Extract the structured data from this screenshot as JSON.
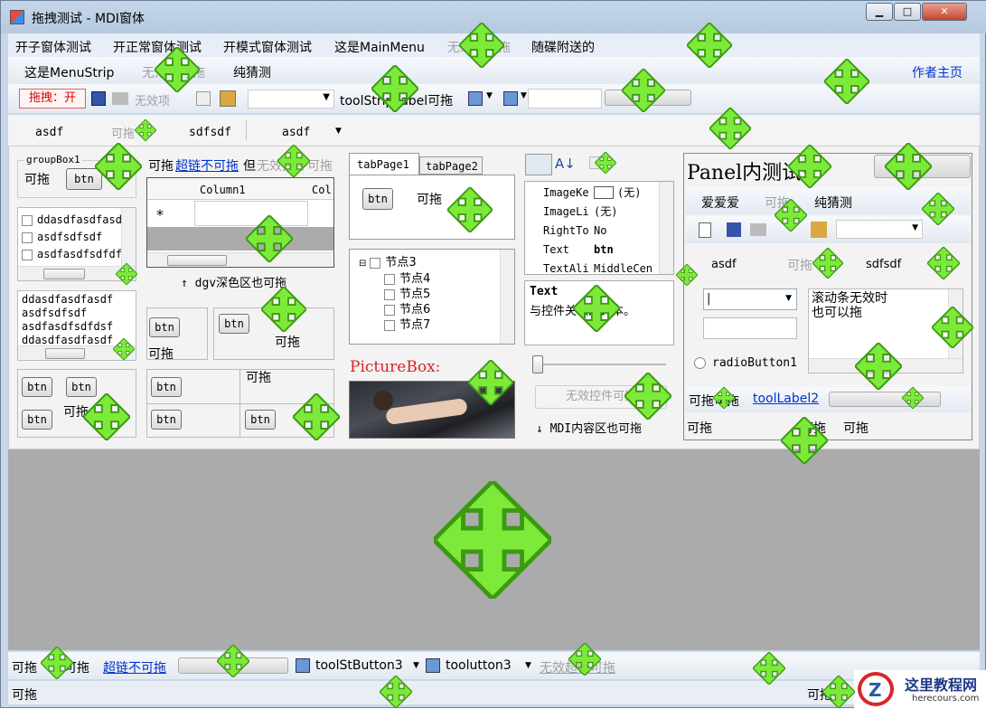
{
  "window": {
    "title": "拖拽测试 - MDI窗体",
    "min": "▁",
    "max": "□",
    "close": "✕"
  },
  "mainmenu": {
    "items": [
      "开子窗体测试",
      "开正常窗体测试",
      "开模式窗体测试",
      "这是MainMenu",
      "无效项可拖",
      "随碟附送的"
    ]
  },
  "menustrip": {
    "items": [
      "这是MenuStrip",
      "无效项可拖",
      "纯猜测"
    ],
    "right_link": "作者主页"
  },
  "toolstrip": {
    "drag_label": "拖拽：开",
    "disabled_item": "无效项",
    "label": "toolStripLabel可拖"
  },
  "tabs": {
    "t1": "asdf",
    "t2": "可拖",
    "t3": "sdfsdf",
    "t4": "asdf"
  },
  "groupbox": {
    "title": "groupBox1",
    "drag": "可拖",
    "btn": "btn"
  },
  "linkrow": {
    "a": "可拖",
    "link": "超链不可拖",
    "b": "但",
    "disabled": "无效控件可拖"
  },
  "checklist": [
    "ddasdfasdfasdf",
    "asdfsdfsdf",
    "asdfasdfsdfdf"
  ],
  "grid": {
    "col1": "Column1",
    "col2": "Col",
    "star": "*",
    "note": "↑ dgv深色区也可拖"
  },
  "textlist": [
    "ddasdfasdfasdf",
    "asdfsdfsdf",
    "asdfasdfsdfdsf",
    "ddasdfasdfasdf"
  ],
  "tabpage": {
    "tab1": "tabPage1",
    "tab2": "tabPage2",
    "btn": "btn",
    "drag": "可拖"
  },
  "tree": {
    "n3": "节点3",
    "n4": "节点4",
    "n5": "节点5",
    "n6": "节点6",
    "n7": "节点7"
  },
  "picture": {
    "label": "PictureBox:"
  },
  "propgrid": {
    "rows": [
      [
        "ImageKe",
        "(无)"
      ],
      [
        "ImageLi",
        "(无)"
      ],
      [
        "RightTo",
        "No"
      ],
      [
        "Text",
        "btn"
      ],
      [
        "TextAli",
        "MiddleCen"
      ]
    ],
    "desc_title": "Text",
    "desc": "与控件关联的文本。"
  },
  "slider": {
    "value": 0
  },
  "disabledbtn": "无效控件可拖",
  "mdinote": "↓ MDI内容区也可拖",
  "panel": {
    "title": "Panel内测试:",
    "menu": [
      "爱爱爱",
      "可拖",
      "纯猜测"
    ],
    "tab1": "asdf",
    "tab2": "可拖",
    "tab3": "sdfsdf",
    "textbox": "滚动条无效时\n也可以拖",
    "radio": "radioButton1",
    "status1": "可拖可拖",
    "status_link": "toolLabel2",
    "bottom1": "可拖",
    "bottom2": "可拖",
    "bottom3": "可拖"
  },
  "btnboxes": {
    "b": "btn",
    "drag": "可拖"
  },
  "bottomstrip": {
    "a": "可拖",
    "b": "可拖",
    "link": "超链不可拖",
    "btn3": "toolStButton3",
    "btn4": "toolutton3",
    "disabled": "无效超链可拖"
  },
  "status": {
    "left": "可拖",
    "right": "可拖"
  },
  "watermark": {
    "title": "这里教程网",
    "url": "herecours.com"
  }
}
